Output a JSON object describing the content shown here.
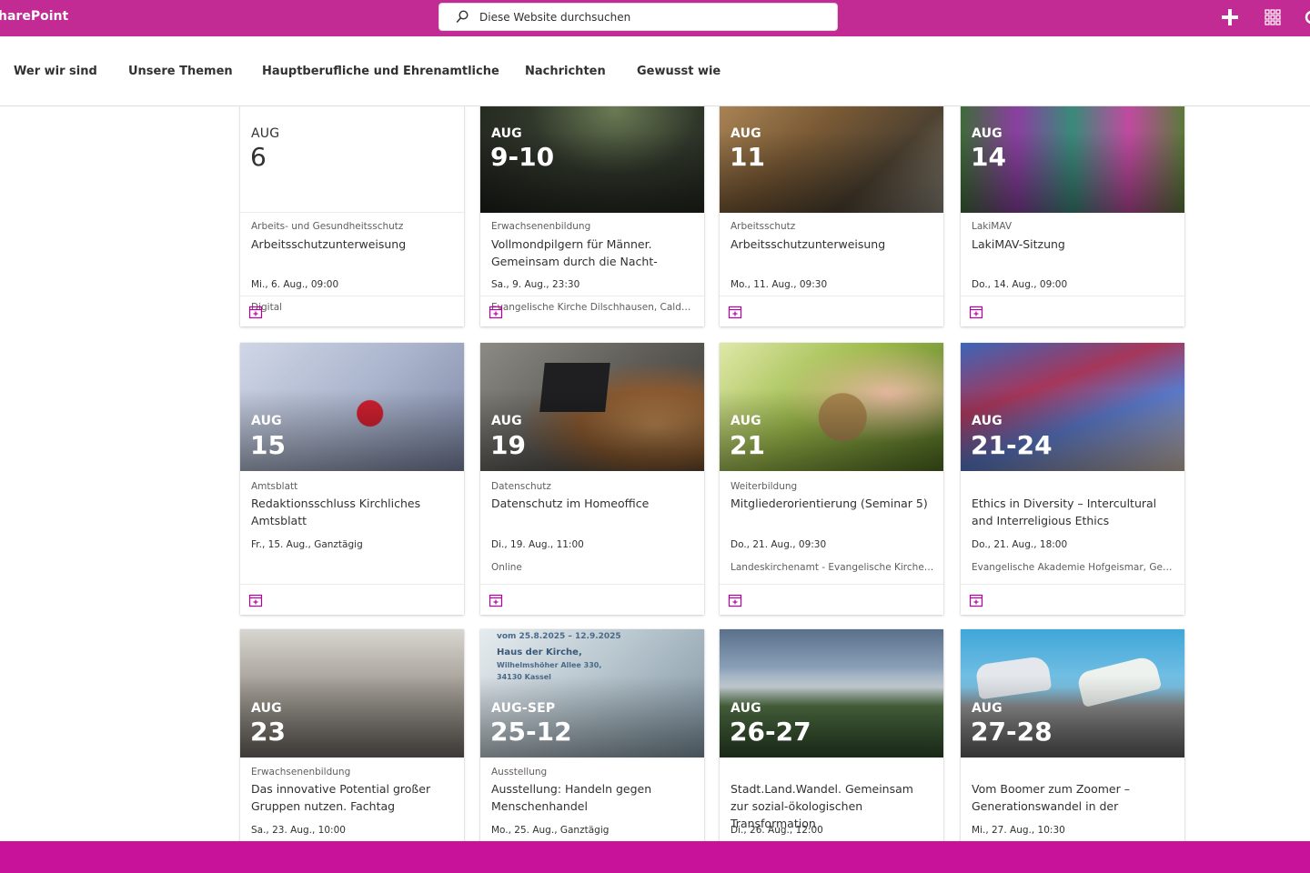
{
  "suite": {
    "brand": "harePoint",
    "search_placeholder": "Diese Website durchsuchen",
    "accent": "#c22a94"
  },
  "nav": [
    "Wer wir sind",
    "Unsere Themen",
    "Hauptberufliche und Ehrenamtliche",
    "Nachrichten",
    "Gewusst wie"
  ],
  "events": [
    {
      "month": "AUG",
      "day": "6",
      "category": "Arbeits- und Gesundheitsschutz",
      "title": "Arbeitsschutzunterweisung",
      "when": "Mi., 6. Aug., 09:00",
      "where": "Digital"
    },
    {
      "month": "AUG",
      "day": "9-10",
      "category": "Erwachsenenbildung",
      "title": "Vollmondpilgern für Männer. Gemeinsam durch die Nacht-",
      "when": "Sa., 9. Aug., 23:30",
      "where": "Evangelische Kirche Dilschhausen, Caldene..."
    },
    {
      "month": "AUG",
      "day": "11",
      "category": "Arbeitsschutz",
      "title": "Arbeitsschutzunterweisung",
      "when": "Mo., 11. Aug., 09:30",
      "where": ""
    },
    {
      "month": "AUG",
      "day": "14",
      "category": "LakiMAV",
      "title": "LakiMAV-Sitzung",
      "when": "Do., 14. Aug., 09:00",
      "where": ""
    },
    {
      "month": "AUG",
      "day": "15",
      "category": "Amtsblatt",
      "title": "Redaktionsschluss Kirchliches Amtsblatt",
      "when": "Fr., 15. Aug., Ganztägig",
      "where": ""
    },
    {
      "month": "AUG",
      "day": "19",
      "category": "Datenschutz",
      "title": "Datenschutz im Homeoffice",
      "when": "Di., 19. Aug., 11:00",
      "where": "Online"
    },
    {
      "month": "AUG",
      "day": "21",
      "category": "Weiterbildung",
      "title": "Mitgliederorientierung (Seminar 5)",
      "when": "Do., 21. Aug., 09:30",
      "where": "Landeskirchenamt - Evangelische Kirche vo..."
    },
    {
      "month": "AUG",
      "day": "21-24",
      "category": "",
      "title": "Ethics in Diversity – Intercultural and Interreligious Ethics",
      "when": "Do., 21. Aug., 18:00",
      "where": "Evangelische Akademie Hofgeismar, Gesun..."
    },
    {
      "month": "AUG",
      "day": "23",
      "category": "Erwachsenenbildung",
      "title": "Das innovative Potential großer Gruppen nutzen. Fachtag",
      "when": "Sa., 23. Aug., 10:00",
      "where": ""
    },
    {
      "month": "AUG-SEP",
      "day": "25-12",
      "category": "Ausstellung",
      "title": "Ausstellung: Handeln gegen Menschenhandel",
      "when": "Mo., 25. Aug., Ganztägig",
      "where": "",
      "poster": [
        "vom 25.8.2025 – 12.9.2025",
        "Haus der Kirche,",
        "Wilhelmshöher Allee 330,",
        "34130 Kassel"
      ]
    },
    {
      "month": "AUG",
      "day": "26-27",
      "category": "",
      "title": "Stadt.Land.Wandel. Gemeinsam zur sozial-ökologischen Transformation",
      "when": "Di., 26. Aug., 12:00",
      "where": ""
    },
    {
      "month": "AUG",
      "day": "27-28",
      "category": "",
      "title": "Vom Boomer zum Zoomer – Generationswandel in der",
      "when": "Mi., 27. Aug., 10:30",
      "where": ""
    }
  ]
}
